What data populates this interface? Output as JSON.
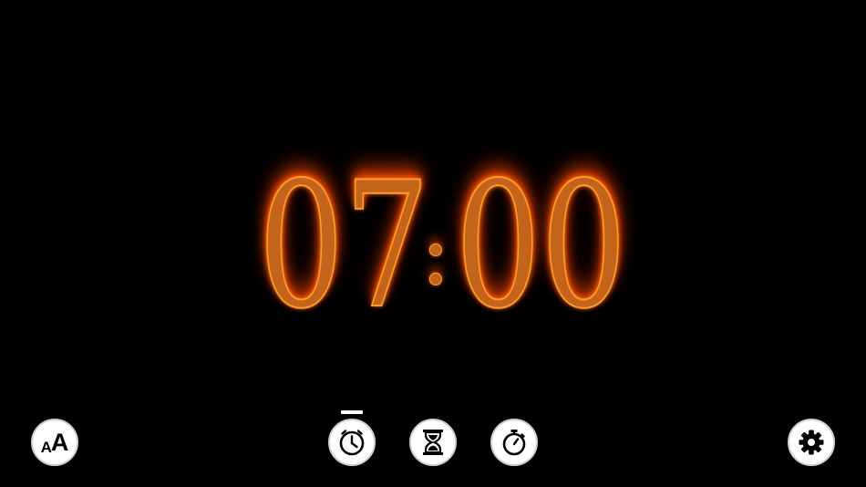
{
  "clock": {
    "hour_tens": "0",
    "hour_ones": "7",
    "separator": ":",
    "minute_tens": "0",
    "minute_ones": "0"
  },
  "toolbar": {
    "font_button_small": "A",
    "font_button_big": "A",
    "active_mode": "clock",
    "icons": {
      "font": "font-size-icon",
      "clock": "clock-icon",
      "timer": "hourglass-icon",
      "stopwatch": "stopwatch-icon",
      "settings": "gear-icon"
    }
  },
  "colors": {
    "background": "#000000",
    "fire": "#c4641a",
    "button": "#ffffff"
  }
}
